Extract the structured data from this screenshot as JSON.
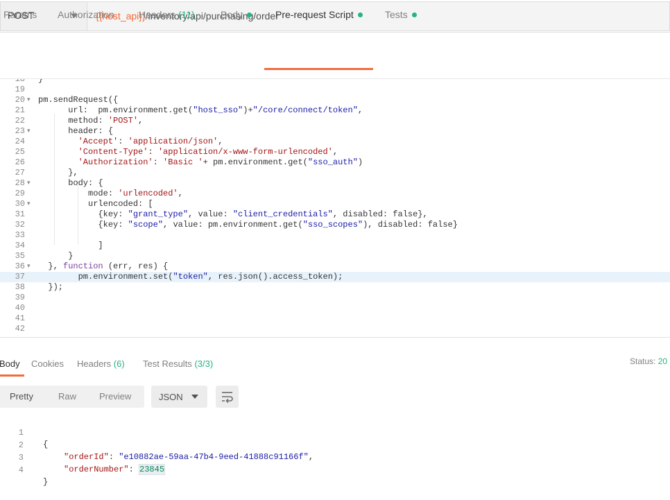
{
  "request": {
    "method": "POST",
    "url_variable": "{{host_api}}",
    "url_path": "/inventory/api/purchasing/order"
  },
  "request_tabs": [
    {
      "label": "Params"
    },
    {
      "label": "Authorization"
    },
    {
      "label": "Headers",
      "count": "(11)"
    },
    {
      "label": "Body"
    },
    {
      "label": "Pre-request Script"
    },
    {
      "label": "Tests"
    }
  ],
  "editor": {
    "lines": [
      {
        "n": "18",
        "fold": "",
        "code": "}"
      },
      {
        "n": "19",
        "fold": "",
        "code": ""
      },
      {
        "n": "20",
        "fold": "▾",
        "code": "pm.sendRequest({"
      },
      {
        "n": "21",
        "fold": "",
        "code": "      url:  pm.environment.get(\"host_sso\")+\"/core/connect/token\","
      },
      {
        "n": "22",
        "fold": "",
        "code": "      method: 'POST',"
      },
      {
        "n": "23",
        "fold": "▾",
        "code": "      header: {"
      },
      {
        "n": "24",
        "fold": "",
        "code": "        'Accept': 'application/json',"
      },
      {
        "n": "25",
        "fold": "",
        "code": "        'Content-Type': 'application/x-www-form-urlencoded',"
      },
      {
        "n": "26",
        "fold": "",
        "code": "        'Authorization': 'Basic '+ pm.environment.get(\"sso_auth\")"
      },
      {
        "n": "27",
        "fold": "",
        "code": "      },"
      },
      {
        "n": "28",
        "fold": "▾",
        "code": "      body: {"
      },
      {
        "n": "29",
        "fold": "",
        "code": "          mode: 'urlencoded',"
      },
      {
        "n": "30",
        "fold": "▾",
        "code": "          urlencoded: ["
      },
      {
        "n": "31",
        "fold": "",
        "code": "            {key: \"grant_type\", value: \"client_credentials\", disabled: false},"
      },
      {
        "n": "32",
        "fold": "",
        "code": "            {key: \"scope\", value: pm.environment.get(\"sso_scopes\"), disabled: false}"
      },
      {
        "n": "33",
        "fold": "",
        "code": ""
      },
      {
        "n": "34",
        "fold": "",
        "code": "            ]"
      },
      {
        "n": "35",
        "fold": "",
        "code": "      }"
      },
      {
        "n": "36",
        "fold": "▾",
        "code": "  }, function (err, res) {"
      },
      {
        "n": "37",
        "fold": "",
        "code": "        pm.environment.set(\"token\", res.json().access_token);"
      },
      {
        "n": "38",
        "fold": "",
        "code": "  });"
      },
      {
        "n": "39",
        "fold": "",
        "code": ""
      },
      {
        "n": "40",
        "fold": "",
        "code": ""
      },
      {
        "n": "41",
        "fold": "",
        "code": ""
      },
      {
        "n": "42",
        "fold": "",
        "code": ""
      }
    ],
    "active_line": "37"
  },
  "response_tabs": [
    {
      "label": "Body"
    },
    {
      "label": "Cookies"
    },
    {
      "label": "Headers",
      "count": "(6)"
    },
    {
      "label": "Test Results",
      "count": "(3/3)"
    }
  ],
  "status": {
    "label": "Status:",
    "value": "20"
  },
  "view_modes": [
    {
      "label": "Pretty"
    },
    {
      "label": "Raw"
    },
    {
      "label": "Preview"
    }
  ],
  "format": {
    "selected": "JSON"
  },
  "response_body": {
    "lines": [
      {
        "n": "1",
        "open": "{"
      },
      {
        "n": "2",
        "key": "\"orderId\"",
        "value": "\"e10882ae-59aa-47b4-9eed-41888c91166f\"",
        "trail": ","
      },
      {
        "n": "3",
        "key": "\"orderNumber\"",
        "value": "23845",
        "trail": ""
      },
      {
        "n": "4",
        "open": "}"
      }
    ]
  },
  "colors": {
    "accent": "#f26b3a",
    "success": "#26b47f"
  }
}
